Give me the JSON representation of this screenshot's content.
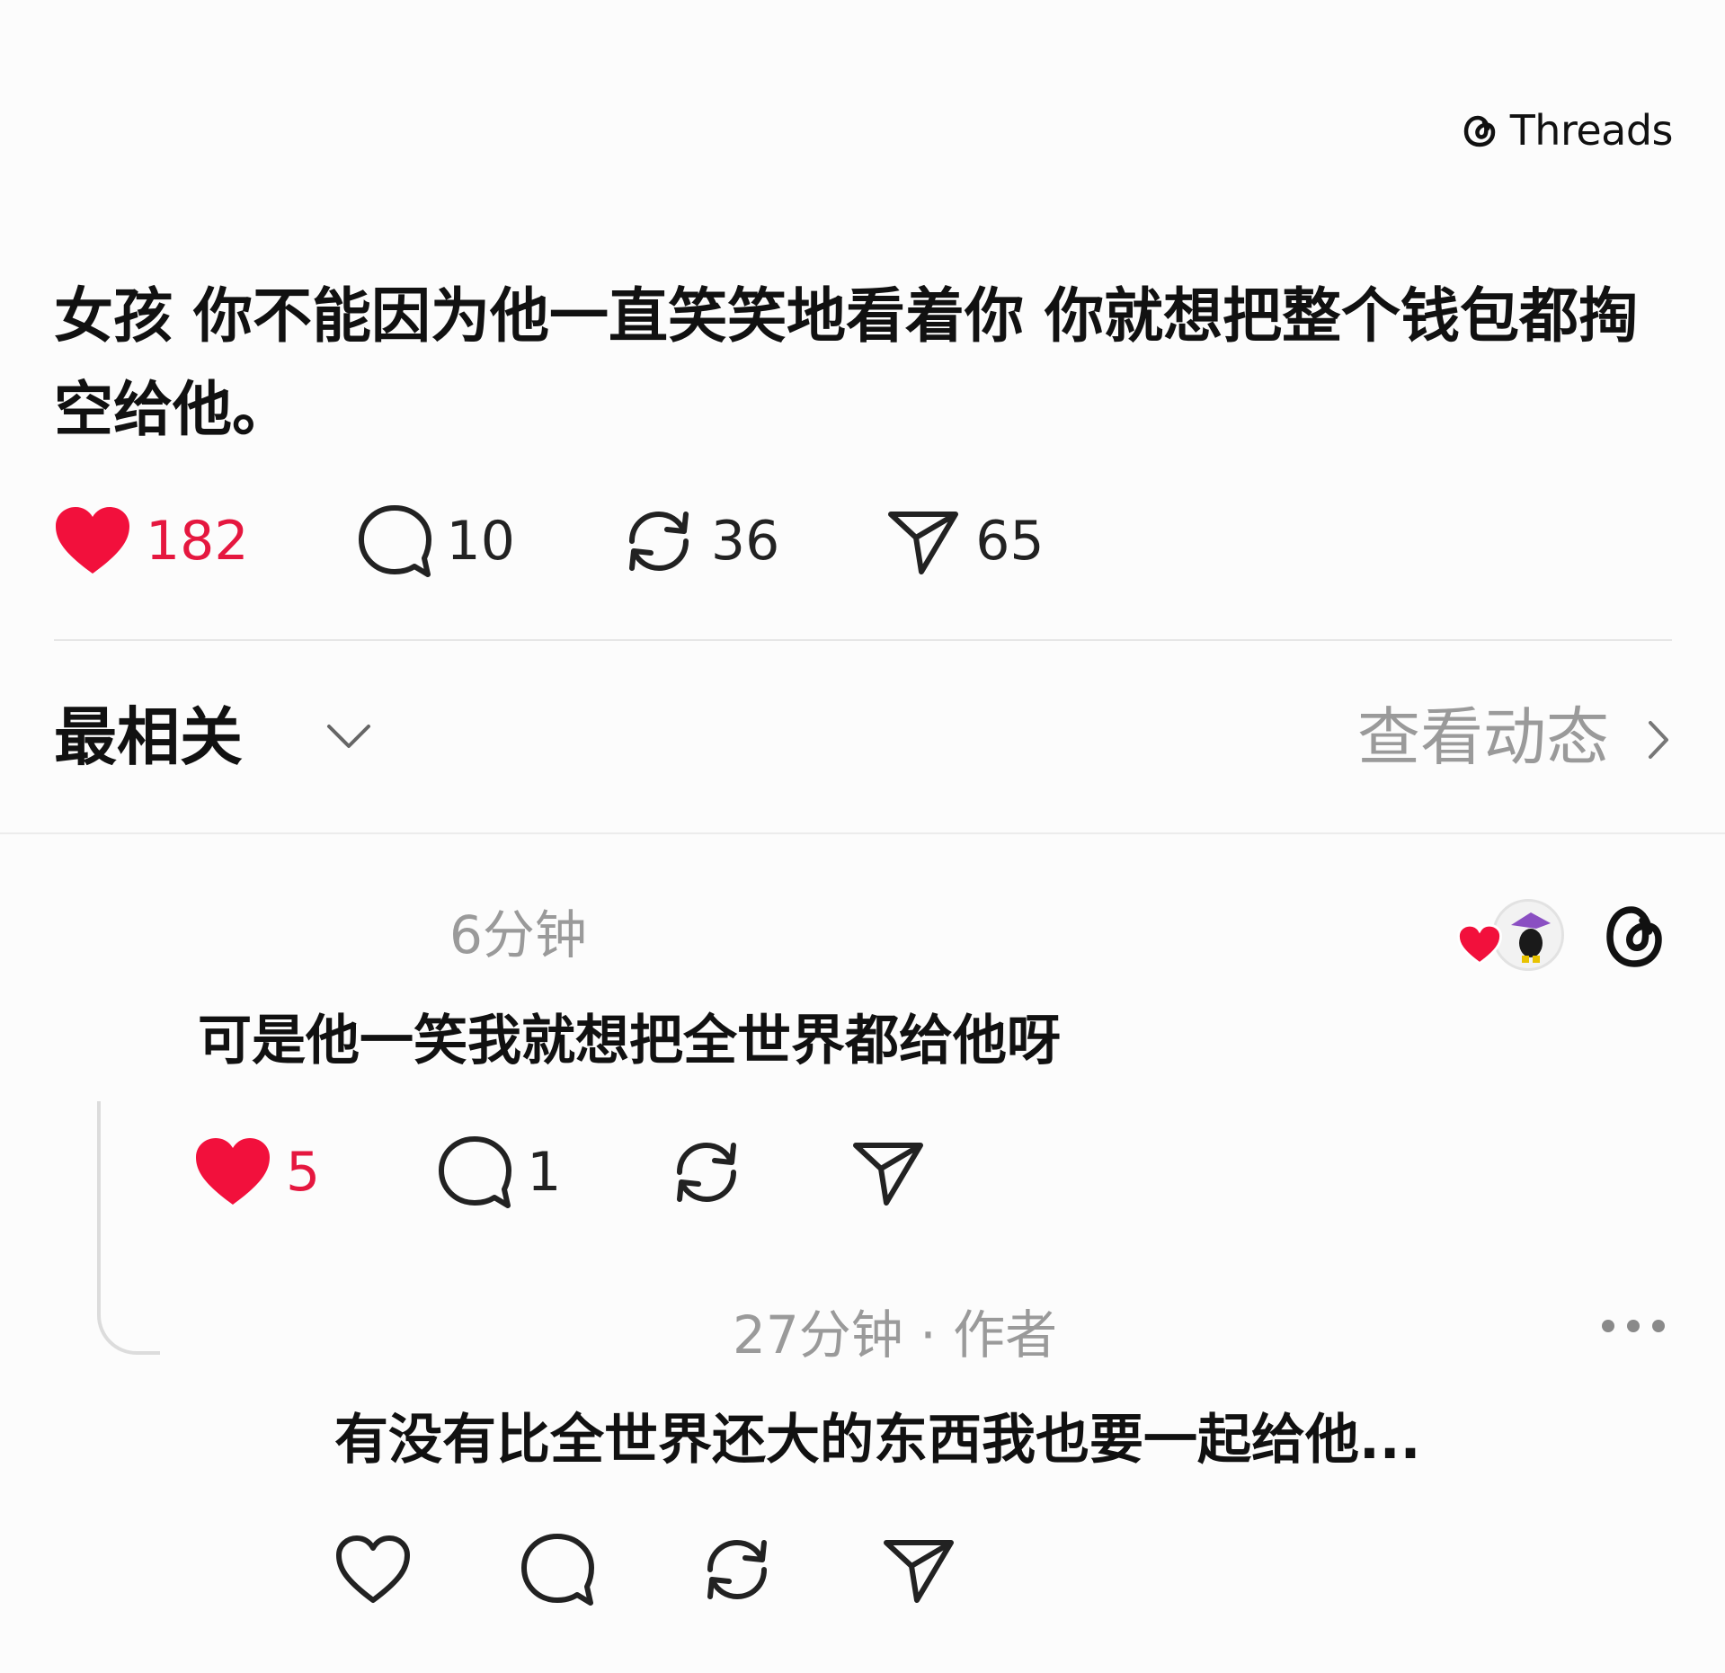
{
  "brand": {
    "label": "Threads"
  },
  "post": {
    "text": "女孩 你不能因为他一直笑笑地看着你 你就想把整个钱包都掏空给他。",
    "likes": "182",
    "replies": "10",
    "reposts": "36",
    "shares": "65"
  },
  "sort": {
    "label": "最相关",
    "activity": "查看动态"
  },
  "comments": [
    {
      "time": "6分钟",
      "text": "可是他一笑我就想把全世界都给他呀",
      "likes": "5",
      "replies": "1"
    },
    {
      "time": "27分钟 · 作者",
      "text": "有没有比全世界还大的东西我也要一起给他..."
    }
  ],
  "colors": {
    "liked": "#e5173f",
    "muted": "#9a9a9a",
    "text": "#111111"
  },
  "icons": [
    "threads-logo",
    "heart",
    "comment-bubble",
    "repost-arrows",
    "send-arrow",
    "chevron-down",
    "chevron-right",
    "more-dots"
  ]
}
